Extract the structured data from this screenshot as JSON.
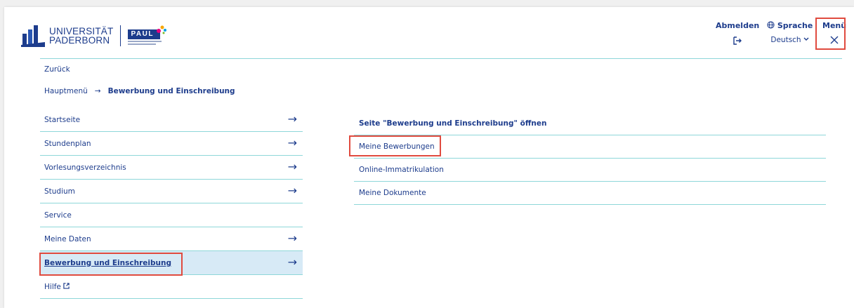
{
  "header": {
    "logo_line1": "UNIVERSITÄT",
    "logo_line2": "PADERBORN",
    "paul_label": "PAUL",
    "logout_label": "Abmelden",
    "logout_icon": "↦",
    "language_label": "Sprache",
    "language_icon": "🌐",
    "language_value": "Deutsch",
    "language_chevron": "⌄",
    "menu_label": "Menü",
    "close_icon": "✕"
  },
  "nav": {
    "back_label": "Zurück",
    "breadcrumb_root": "Hauptmenü",
    "breadcrumb_arrow": "→",
    "breadcrumb_current": "Bewerbung und Einschreibung"
  },
  "left_menu": {
    "arrow": "→",
    "items": [
      {
        "label": "Startseite"
      },
      {
        "label": "Stundenplan"
      },
      {
        "label": "Vorlesungsverzeichnis"
      },
      {
        "label": "Studium"
      },
      {
        "label": "Service"
      },
      {
        "label": "Meine Daten"
      },
      {
        "label": "Bewerbung und Einschreibung"
      },
      {
        "label": "Hilfe",
        "external_icon": "↗"
      }
    ]
  },
  "submenu": {
    "open_page_label": "Seite \"Bewerbung und Einschreibung\" öffnen",
    "items": [
      {
        "label": "Meine Bewerbungen"
      },
      {
        "label": "Online-Immatrikulation"
      },
      {
        "label": "Meine Dokumente"
      }
    ]
  },
  "colors": {
    "brand_blue": "#1d3c8c",
    "accent_teal": "#8ed7d9",
    "active_bg": "#d7eaf6",
    "highlight_red": "#e04b3f"
  }
}
